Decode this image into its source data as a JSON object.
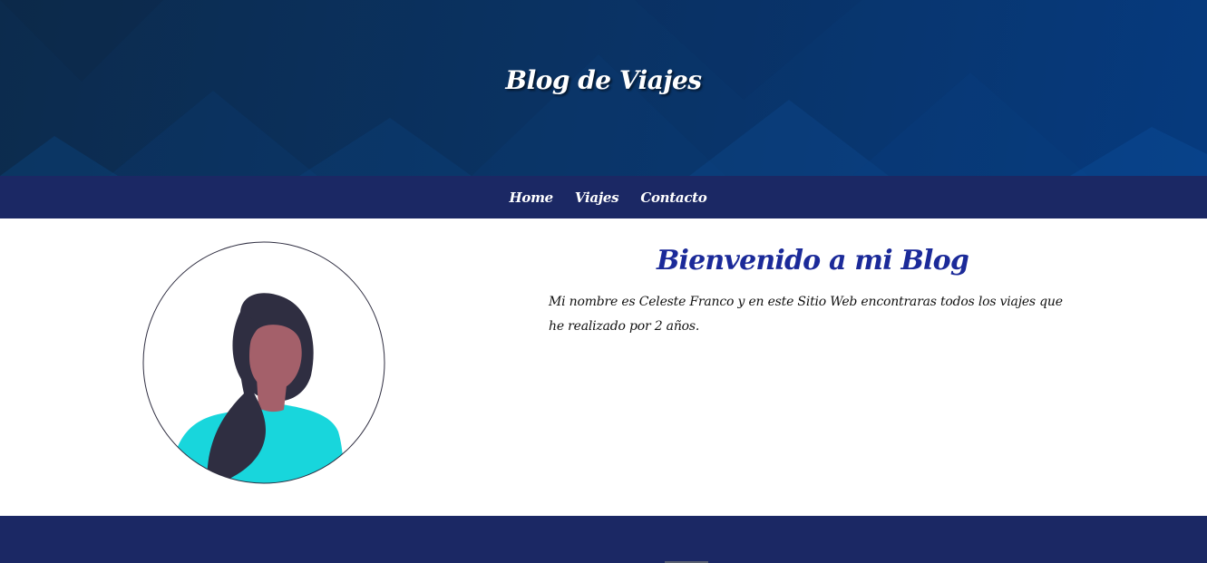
{
  "header": {
    "title": "Blog de Viajes"
  },
  "nav": {
    "items": [
      {
        "label": "Home"
      },
      {
        "label": "Viajes"
      },
      {
        "label": "Contacto"
      }
    ]
  },
  "main": {
    "heading": "Bienvenido a mi Blog",
    "intro": "Mi nombre es Celeste Franco y en este Sitio Web encontraras todos los viajes que he realizado por 2 años.",
    "avatar_icon": "person-avatar-icon"
  },
  "colors": {
    "header_bg": "#0a3262",
    "nav_bg": "#1b2864",
    "heading": "#1b2a99",
    "footer_bg": "#1b2864",
    "avatar_shirt": "#18d6dc",
    "avatar_skin": "#a4606a",
    "avatar_hair": "#2f2e41"
  }
}
